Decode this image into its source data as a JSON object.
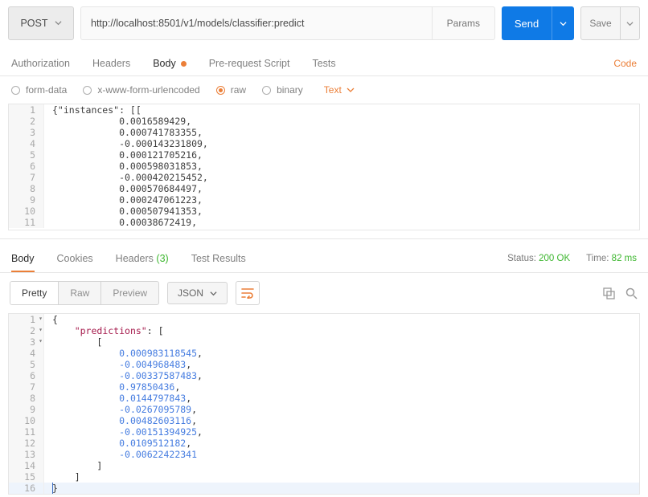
{
  "request": {
    "method": "POST",
    "url": "http://localhost:8501/v1/models/classifier:predict",
    "params_label": "Params",
    "send_label": "Send",
    "save_label": "Save"
  },
  "req_tabs": {
    "authorization": "Authorization",
    "headers": "Headers",
    "body": "Body",
    "prerequest": "Pre-request Script",
    "tests": "Tests",
    "code": "Code"
  },
  "body_types": {
    "form": "form-data",
    "urlenc": "x-www-form-urlencoded",
    "raw": "raw",
    "binary": "binary",
    "text_sel": "Text"
  },
  "req_body_lines": [
    "{\"instances\": [[",
    "            0.0016589429,",
    "            0.000741783355,",
    "            -0.000143231809,",
    "            0.000121705216,",
    "            0.000598031853,",
    "            -0.000420215452,",
    "            0.000570684497,",
    "            0.000247061223,",
    "            0.000507941353,",
    "            0.00038672419,"
  ],
  "resp_tabs": {
    "body": "Body",
    "cookies": "Cookies",
    "headers": "Headers",
    "headers_count": "(3)",
    "tests": "Test Results"
  },
  "resp_status": {
    "status_label": "Status:",
    "status_value": "200 OK",
    "time_label": "Time:",
    "time_value": "82 ms"
  },
  "resp_toolbar": {
    "pretty": "Pretty",
    "raw": "Raw",
    "preview": "Preview",
    "fmt": "JSON"
  },
  "resp_body_lines": [
    {
      "t": "{",
      "fold": true
    },
    {
      "t": "    \"predictions\": [",
      "key": "predictions",
      "fold": true
    },
    {
      "t": "        [",
      "fold": true
    },
    {
      "t": "            0.000983118545,",
      "num": "0.000983118545"
    },
    {
      "t": "            -0.004968483,",
      "num": "-0.004968483"
    },
    {
      "t": "            -0.00337587483,",
      "num": "-0.00337587483"
    },
    {
      "t": "            0.97850436,",
      "num": "0.97850436"
    },
    {
      "t": "            0.0144797843,",
      "num": "0.0144797843"
    },
    {
      "t": "            -0.0267095789,",
      "num": "-0.0267095789"
    },
    {
      "t": "            0.00482603116,",
      "num": "0.00482603116"
    },
    {
      "t": "            -0.00151394925,",
      "num": "-0.00151394925"
    },
    {
      "t": "            0.0109512182,",
      "num": "0.0109512182"
    },
    {
      "t": "            -0.00622422341",
      "num": "-0.00622422341"
    },
    {
      "t": "        ]"
    },
    {
      "t": "    ]"
    },
    {
      "t": "}",
      "hl": true
    }
  ],
  "chart_data": {
    "type": "table",
    "title": "classifier:predict request/response",
    "request_instances_first_values": [
      0.0016589429,
      0.000741783355,
      -0.000143231809,
      0.000121705216,
      0.000598031853,
      -0.000420215452,
      0.000570684497,
      0.000247061223,
      0.000507941353,
      0.00038672419
    ],
    "response_predictions": [
      0.000983118545,
      -0.004968483,
      -0.00337587483,
      0.97850436,
      0.0144797843,
      -0.0267095789,
      0.00482603116,
      -0.00151394925,
      0.0109512182,
      -0.00622422341
    ]
  }
}
